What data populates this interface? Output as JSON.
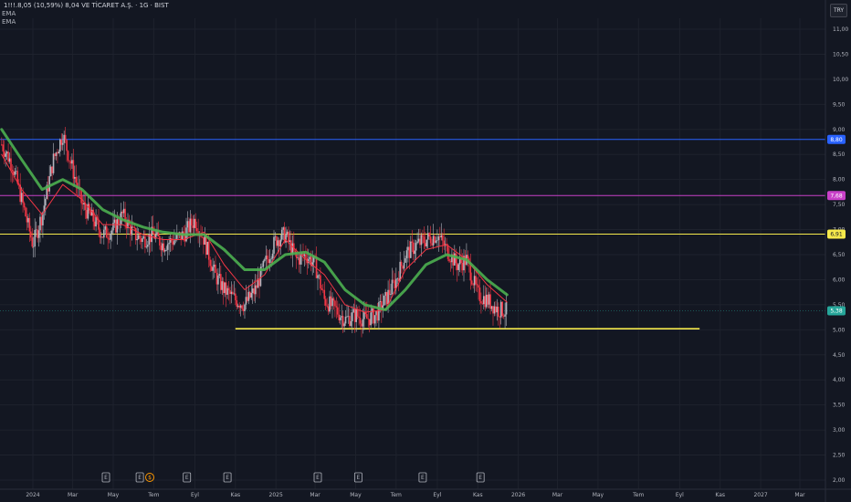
{
  "header": {
    "symbol_line": "1!!!.8,05 (10,59%) 8,04 VE TİCARET A.Ş. · 1G · BIST",
    "indicators": [
      "EMA",
      "EMA"
    ]
  },
  "currency_badge": "TRY",
  "colors": {
    "background": "#131722",
    "grid": "#1e222d",
    "candle_up": "#b2b5be",
    "candle_down": "#f23645",
    "ema_fast": "#f23645",
    "ema_slow": "#4caf50",
    "blue_line": "#2962ff",
    "magenta_line": "#c840c8",
    "yellow_line": "#f5e94b",
    "current_price": "#26a69a"
  },
  "chart_data": {
    "type": "line",
    "title": "",
    "xlabel": "",
    "ylabel": "",
    "x_ticks": [
      "2024",
      "Mar",
      "May",
      "Tem",
      "Eyl",
      "Kas",
      "2025",
      "Mar",
      "May",
      "Tem",
      "Eyl",
      "Kas",
      "2026",
      "Mar",
      "May",
      "Tem",
      "Eyl",
      "Kas",
      "2027",
      "Mar"
    ],
    "x_tick_dates": [
      "2024-01",
      "2024-03",
      "2024-05",
      "2024-07",
      "2024-09",
      "2024-11",
      "2025-01",
      "2025-03",
      "2025-05",
      "2025-07",
      "2025-09",
      "2025-11",
      "2026-01",
      "2026-03",
      "2026-05",
      "2026-07",
      "2026-09",
      "2026-11",
      "2027-01",
      "2027-03"
    ],
    "y_ticks": [
      "11,00",
      "10,50",
      "10,00",
      "9,50",
      "9,00",
      "8,50",
      "8,00",
      "7,50",
      "7,00",
      "6,50",
      "6,00",
      "5,50",
      "5,00",
      "4,50",
      "4,00",
      "3,50",
      "3,00",
      "2,50",
      "2,00"
    ],
    "ylim": [
      2.0,
      11.0
    ],
    "grid": true,
    "series": [
      {
        "name": "",
        "kind": "price",
        "x": [
          "2023-11-15",
          "2023-12-01",
          "2023-12-15",
          "2024-01-01",
          "2024-01-15",
          "2024-02-01",
          "2024-02-15",
          "2024-03-01",
          "2024-03-15",
          "2024-04-01",
          "2024-04-15",
          "2024-05-01",
          "2024-05-15",
          "2024-06-01",
          "2024-06-15",
          "2024-07-01",
          "2024-07-15",
          "2024-08-01",
          "2024-08-15",
          "2024-09-01",
          "2024-09-15",
          "2024-10-01",
          "2024-10-15",
          "2024-11-01",
          "2024-11-15",
          "2024-12-01",
          "2024-12-15",
          "2025-01-01",
          "2025-01-15",
          "2025-02-01",
          "2025-02-15",
          "2025-03-01",
          "2025-03-15",
          "2025-04-01",
          "2025-04-15",
          "2025-05-01",
          "2025-05-15",
          "2025-06-01",
          "2025-06-15",
          "2025-07-01",
          "2025-07-15",
          "2025-08-01",
          "2025-08-15",
          "2025-09-01",
          "2025-09-15",
          "2025-10-01",
          "2025-10-15",
          "2025-11-01",
          "2025-11-15",
          "2025-12-01",
          "2025-12-15"
        ],
        "values": [
          8.7,
          8.3,
          7.6,
          6.7,
          7.3,
          8.4,
          8.9,
          8.2,
          7.5,
          7.2,
          6.9,
          7.0,
          7.3,
          6.9,
          6.8,
          6.9,
          6.7,
          6.8,
          6.9,
          7.2,
          6.8,
          6.1,
          5.8,
          5.6,
          5.5,
          5.8,
          6.3,
          6.8,
          6.9,
          6.4,
          6.5,
          6.3,
          5.6,
          5.4,
          5.2,
          5.3,
          5.2,
          5.3,
          5.6,
          6.0,
          6.5,
          6.7,
          6.8,
          6.9,
          6.6,
          6.3,
          6.4,
          5.7,
          5.6,
          5.4,
          5.38
        ]
      },
      {
        "name": "",
        "kind": "ema_fast",
        "x": [
          "2023-11-15",
          "2023-12-15",
          "2024-01-15",
          "2024-02-15",
          "2024-03-15",
          "2024-04-15",
          "2024-05-15",
          "2024-06-15",
          "2024-07-15",
          "2024-08-15",
          "2024-09-15",
          "2024-10-15",
          "2024-11-15",
          "2024-12-15",
          "2025-01-15",
          "2025-02-15",
          "2025-03-15",
          "2025-04-15",
          "2025-05-15",
          "2025-06-15",
          "2025-07-15",
          "2025-08-15",
          "2025-09-15",
          "2025-10-15",
          "2025-11-15",
          "2025-12-15"
        ],
        "values": [
          8.5,
          7.8,
          7.3,
          7.9,
          7.6,
          7.1,
          7.1,
          6.9,
          6.8,
          6.8,
          6.95,
          6.3,
          5.8,
          6.1,
          6.8,
          6.4,
          6.1,
          5.5,
          5.35,
          5.4,
          6.2,
          6.6,
          6.7,
          6.4,
          5.9,
          5.55
        ]
      },
      {
        "name": "",
        "kind": "ema_slow",
        "x": [
          "2023-11-15",
          "2023-12-15",
          "2024-01-15",
          "2024-02-15",
          "2024-03-15",
          "2024-04-15",
          "2024-05-15",
          "2024-06-15",
          "2024-07-15",
          "2024-08-15",
          "2024-09-15",
          "2024-10-15",
          "2024-11-15",
          "2024-12-15",
          "2025-01-15",
          "2025-02-15",
          "2025-03-15",
          "2025-04-15",
          "2025-05-15",
          "2025-06-15",
          "2025-07-15",
          "2025-08-15",
          "2025-09-15",
          "2025-10-15",
          "2025-11-15",
          "2025-12-15"
        ],
        "values": [
          9.0,
          8.4,
          7.8,
          8.0,
          7.8,
          7.4,
          7.2,
          7.05,
          6.95,
          6.9,
          6.9,
          6.6,
          6.2,
          6.2,
          6.5,
          6.55,
          6.35,
          5.8,
          5.5,
          5.4,
          5.8,
          6.3,
          6.5,
          6.4,
          6.0,
          5.7
        ]
      }
    ],
    "horizontal_lines": [
      {
        "value": 8.8,
        "label": "8,80",
        "color": "#2962ff"
      },
      {
        "value": 7.68,
        "label": "7,68",
        "color": "#c840c8"
      },
      {
        "value": 6.91,
        "label": "6,91",
        "color": "#f5e94b"
      }
    ],
    "support_line": {
      "value": 5.02,
      "x_start": "2024-11-01",
      "x_end": "2026-10-01",
      "color": "#f5e94b"
    },
    "current_price": {
      "value": 5.38,
      "label": "5,38",
      "color": "#26a69a"
    },
    "events": [
      {
        "date": "2024-04-20",
        "label": "E"
      },
      {
        "date": "2024-06-10",
        "label": "E"
      },
      {
        "date": "2024-06-25",
        "label": "$"
      },
      {
        "date": "2024-08-20",
        "label": "E"
      },
      {
        "date": "2024-10-20",
        "label": "E"
      },
      {
        "date": "2025-03-05",
        "label": "E"
      },
      {
        "date": "2025-05-05",
        "label": "E"
      },
      {
        "date": "2025-08-10",
        "label": "E"
      },
      {
        "date": "2025-11-05",
        "label": "E"
      }
    ]
  }
}
